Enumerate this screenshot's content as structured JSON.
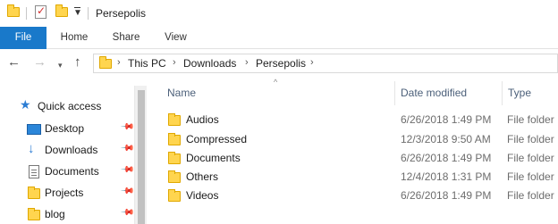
{
  "window": {
    "title": "Persepolis"
  },
  "ribbon": {
    "tabs": [
      "File",
      "Home",
      "Share",
      "View"
    ]
  },
  "nav": {
    "back": "←",
    "forward": "→",
    "recent": "⌄",
    "up": "↑",
    "path": [
      "This PC",
      "Downloads",
      "Persepolis"
    ],
    "separator": "›"
  },
  "sidebar": {
    "items": [
      {
        "label": "Quick access",
        "icon": "star-icon"
      },
      {
        "label": "Desktop",
        "icon": "desktop-icon",
        "pinned": true
      },
      {
        "label": "Downloads",
        "icon": "download-icon",
        "pinned": true
      },
      {
        "label": "Documents",
        "icon": "document-icon",
        "pinned": true
      },
      {
        "label": "Projects",
        "icon": "folder-icon",
        "pinned": true
      },
      {
        "label": "blog",
        "icon": "folder-icon",
        "pinned": true
      }
    ]
  },
  "columns": {
    "name": "Name",
    "date": "Date modified",
    "type": "Type"
  },
  "files": [
    {
      "name": "Audios",
      "date": "6/26/2018 1:49 PM",
      "type": "File folder"
    },
    {
      "name": "Compressed",
      "date": "12/3/2018 9:50 AM",
      "type": "File folder"
    },
    {
      "name": "Documents",
      "date": "6/26/2018 1:49 PM",
      "type": "File folder"
    },
    {
      "name": "Others",
      "date": "12/4/2018 1:31 PM",
      "type": "File folder"
    },
    {
      "name": "Videos",
      "date": "6/26/2018 1:49 PM",
      "type": "File folder"
    }
  ],
  "colors": {
    "accent": "#1979ca",
    "folder": "#ffd54f",
    "header_text": "#4c607a"
  }
}
